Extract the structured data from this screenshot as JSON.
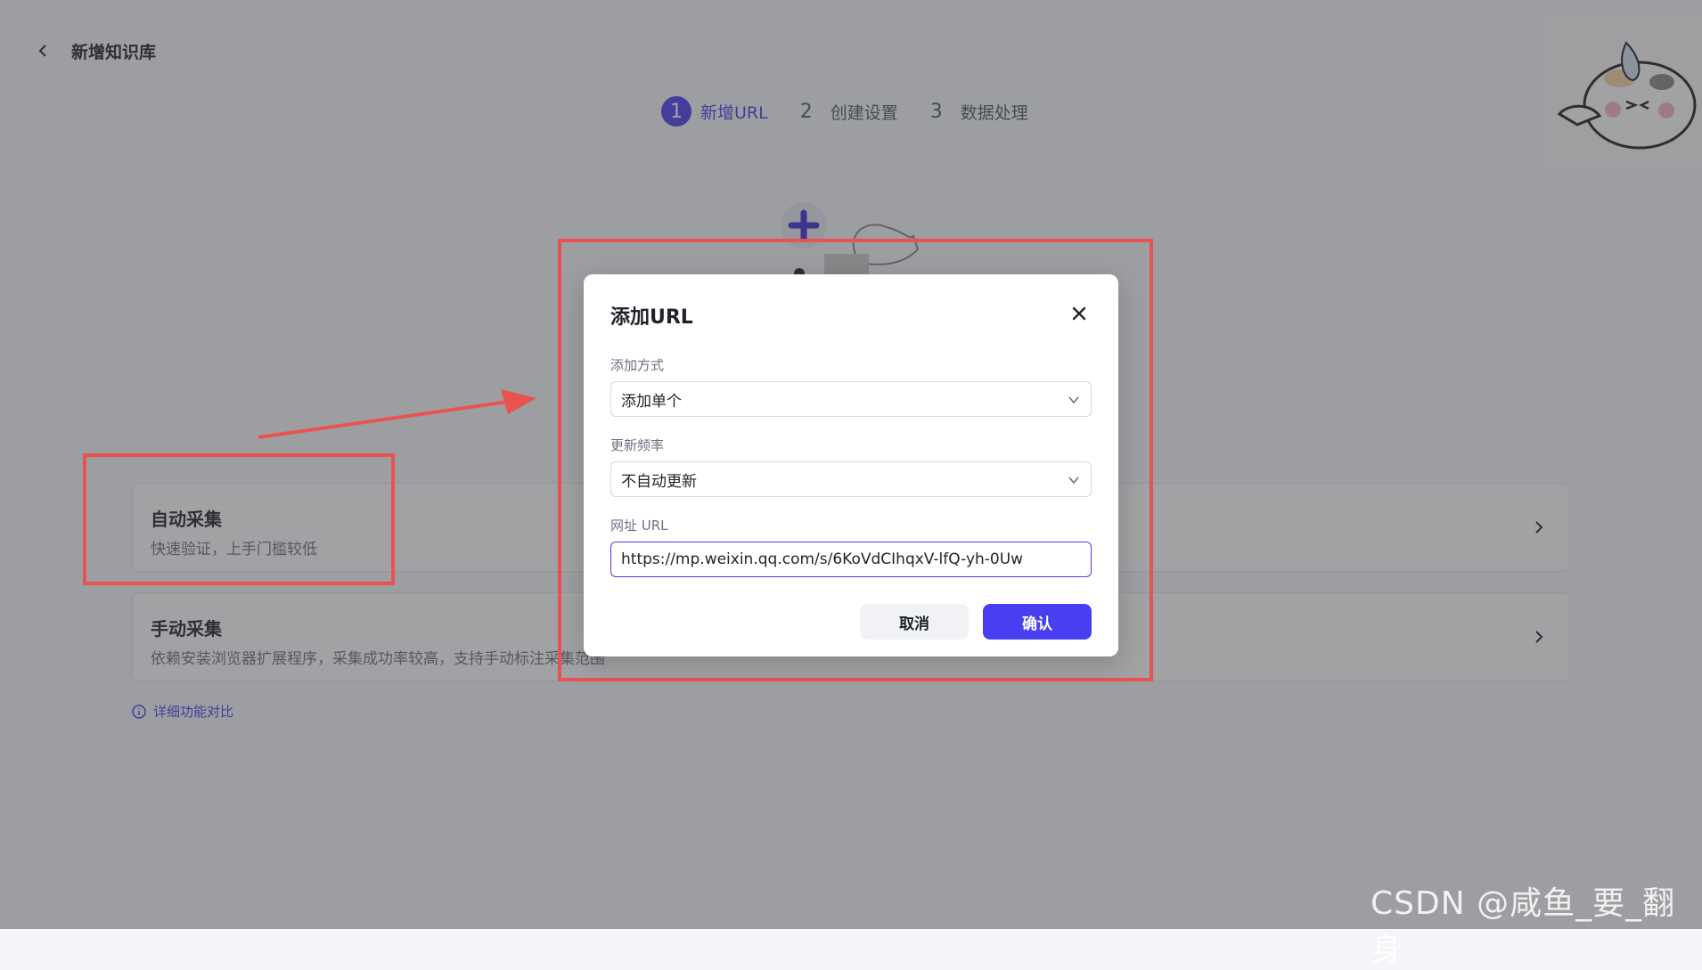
{
  "header": {
    "title": "新增知识库"
  },
  "steps": [
    {
      "num": "1",
      "label": "新增URL"
    },
    {
      "num": "2",
      "label": "创建设置"
    },
    {
      "num": "3",
      "label": "数据处理"
    }
  ],
  "cards": [
    {
      "title": "自动采集",
      "desc": "快速验证，上手门槛较低"
    },
    {
      "title": "手动采集",
      "desc": "依赖安装浏览器扩展程序，采集成功率较高，支持手动标注采集范围"
    }
  ],
  "compare_link": "详细功能对比",
  "modal": {
    "title": "添加URL",
    "method_label": "添加方式",
    "method_value": "添加单个",
    "frequency_label": "更新频率",
    "frequency_value": "不自动更新",
    "url_label": "网址 URL",
    "url_value": "https://mp.weixin.qq.com/s/6KoVdCIhqxV-lfQ-yh-0Uw",
    "cancel": "取消",
    "confirm": "确认"
  },
  "watermark": "CSDN @咸鱼_要_翻身",
  "colors": {
    "accent": "#4a3ff0",
    "annotation": "#e9524f"
  }
}
